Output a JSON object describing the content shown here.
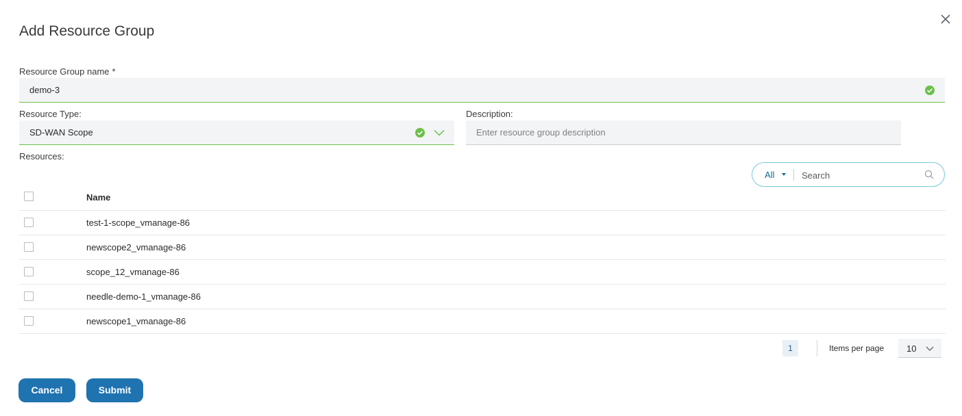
{
  "dialog": {
    "title": "Add Resource Group",
    "close_icon": "close-icon"
  },
  "form": {
    "name_label": "Resource Group name",
    "name_required_marker": "*",
    "name_value": "demo-3",
    "type_label": "Resource Type:",
    "type_value": "SD-WAN Scope",
    "description_label": "Description:",
    "description_placeholder": "Enter resource group description",
    "resources_label": "Resources:"
  },
  "search": {
    "filter_value": "All",
    "placeholder": "Search"
  },
  "table": {
    "header_name": "Name",
    "rows": [
      {
        "name": "test-1-scope_vmanage-86"
      },
      {
        "name": "newscope2_vmanage-86"
      },
      {
        "name": "scope_12_vmanage-86"
      },
      {
        "name": "needle-demo-1_vmanage-86"
      },
      {
        "name": "newscope1_vmanage-86"
      }
    ]
  },
  "pagination": {
    "current_page": "1",
    "items_per_page_label": "Items per page",
    "items_per_page_value": "10"
  },
  "actions": {
    "cancel_label": "Cancel",
    "submit_label": "Submit"
  },
  "colors": {
    "primary_button": "#1f73b0",
    "valid_green": "#6cc04a",
    "search_border": "#7cc6d9"
  }
}
